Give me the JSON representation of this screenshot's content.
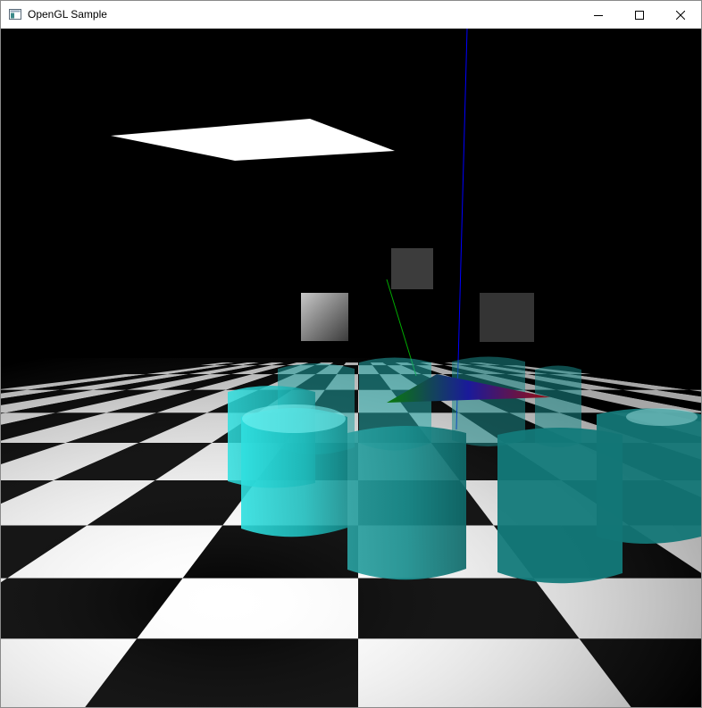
{
  "window": {
    "title": "OpenGL Sample",
    "controls": {
      "minimize": "minimize-icon",
      "maximize": "maximize-icon",
      "close": "close-icon"
    }
  },
  "scene": {
    "background_color": "#000000",
    "floor_colors": [
      "#ffffff",
      "#000000"
    ],
    "cylinder_color": "#1fd6d6",
    "axis_colors": {
      "x": "#ff0000",
      "y": "#00aa00",
      "z": "#0000ff"
    }
  }
}
